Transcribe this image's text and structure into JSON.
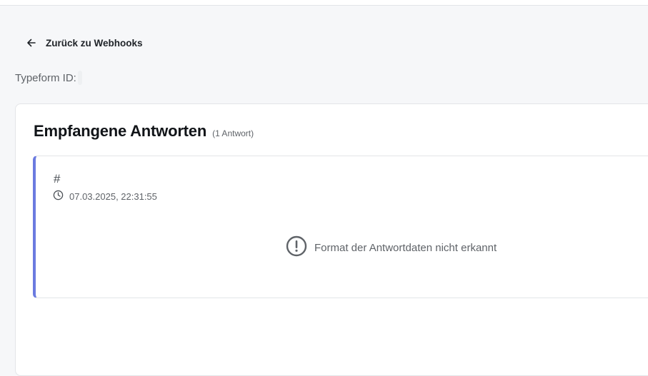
{
  "nav": {
    "back_icon": "arrow-left-icon",
    "back_label": "Zurück zu Webhooks"
  },
  "meta": {
    "typeform_label": "Typeform ID:",
    "typeform_value": ""
  },
  "responses_section": {
    "title": "Empfangene Antworten",
    "count_label": "(1 Antwort)",
    "items": [
      {
        "id_label": "#",
        "clock_icon": "clock-icon",
        "timestamp": "07.03.2025, 22:31:55",
        "warning_icon": "alert-circle-icon",
        "message": "Format der Antwortdaten nicht erkannt"
      }
    ]
  },
  "colors": {
    "accent": "#6b7be0",
    "background": "#f6f7f9",
    "card": "#ffffff",
    "border": "#e3e5e8",
    "muted_text": "#5f6368"
  }
}
